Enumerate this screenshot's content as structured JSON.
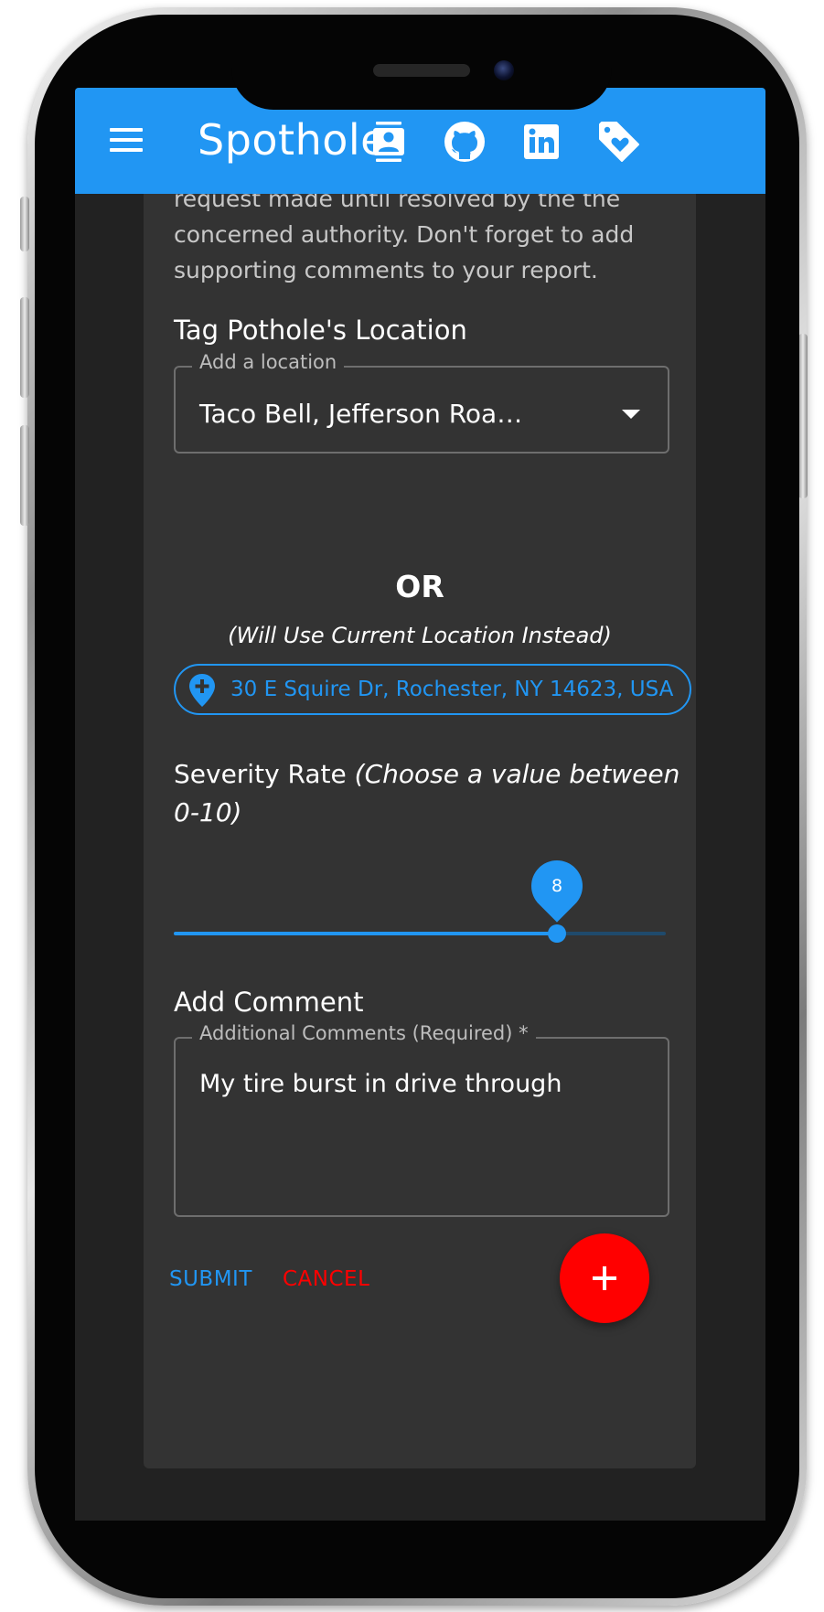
{
  "app_bar": {
    "title": "Spothole",
    "menu_icon": "hamburger-menu-icon",
    "icons": [
      "contacts-icon",
      "github-icon",
      "linkedin-icon",
      "tag-heart-icon"
    ],
    "color": "#2196f3"
  },
  "form": {
    "intro_text": "request made until resolved by the the\nconcerned authority. Don't forget to add\nsupporting comments to your report.",
    "location_section_title": "Tag Pothole's Location",
    "location_select": {
      "label": "Add a location",
      "value": "Taco Bell, Jefferson Roa…"
    },
    "or_text": "OR",
    "current_location_note": "(Will Use Current Location Instead)",
    "current_location_chip": {
      "icon": "add-location-pin-icon",
      "label": "30 E Squire Dr, Rochester, NY 14623, USA"
    },
    "severity": {
      "label": "Severity Rate ",
      "hint": "(Choose a value between 0-10)",
      "value": "8",
      "min": 0,
      "max": 10,
      "fraction": 0.778
    },
    "comment_section_title": "Add Comment",
    "comment_field": {
      "label": "Additional Comments (Required) *",
      "value": "My tire burst in drive through"
    },
    "submit_label": "SUBMIT",
    "cancel_label": "CANCEL"
  },
  "fab": {
    "icon": "plus-icon",
    "color": "#ff0000"
  },
  "colors": {
    "primary": "#2196f3",
    "danger": "#ff0000",
    "card": "#333333",
    "background": "#222222"
  }
}
